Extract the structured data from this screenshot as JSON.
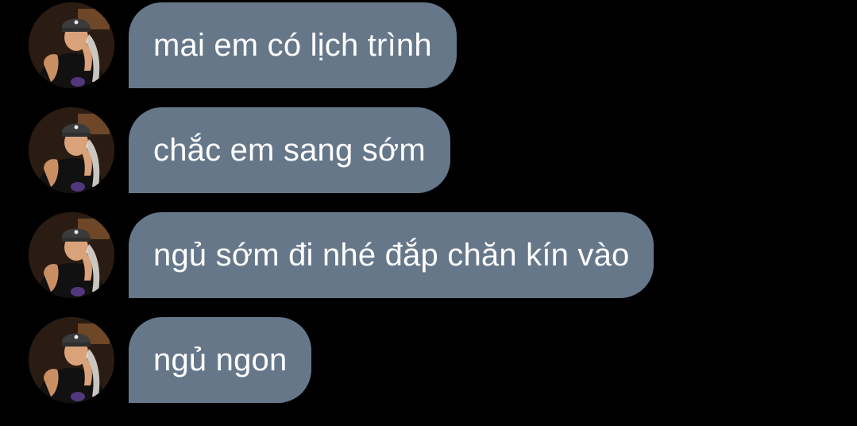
{
  "messages": [
    {
      "text": "mai em có lịch trình",
      "avatar": "profile-photo"
    },
    {
      "text": "chắc em sang sớm",
      "avatar": "profile-photo"
    },
    {
      "text": "ngủ sớm đi nhé đắp chăn kín vào",
      "avatar": "profile-photo"
    },
    {
      "text": "ngủ ngon",
      "avatar": "profile-photo"
    }
  ],
  "colors": {
    "background": "#000000",
    "bubble": "#66778a",
    "bubble_text": "#ffffff"
  }
}
